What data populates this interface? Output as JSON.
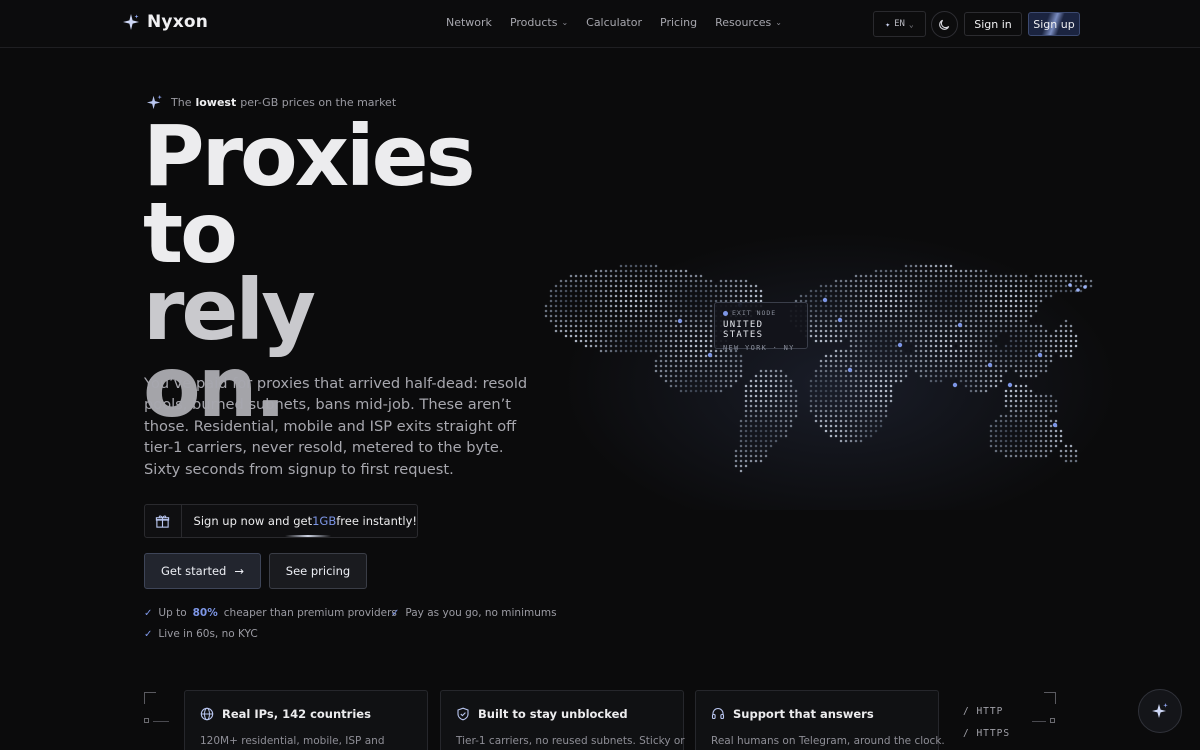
{
  "nav": {
    "brand": "Nyxon",
    "links": [
      "Network",
      "Products",
      "Calculator",
      "Pricing",
      "Resources"
    ],
    "language": "EN",
    "sign_in": "Sign in",
    "sign_up": "Sign up"
  },
  "hero": {
    "tagline_prefix": "The",
    "tagline_bold": "lowest",
    "tagline_suffix": "per-GB prices on the market",
    "title_line1": "Proxies to",
    "title_line2": "rely",
    "title_line3": "on.",
    "description": "You’ve paid for proxies that arrived half-dead: resold pools, burned subnets, bans mid-job. These aren’t those. Residential, mobile and ISP exits straight off tier-1 carriers, never resold, metered to the byte. Sixty seconds from signup to first request.",
    "promo_prefix": "Sign up now and get",
    "promo_accent": "1GB",
    "promo_suffix": "free instantly!",
    "cta_primary": "Get started",
    "cta_arrow": "→",
    "cta_secondary": "See pricing",
    "features": {
      "f1_prefix": "Up to",
      "f1_value": "80%",
      "f1_suffix": "cheaper than premium providers",
      "f2": "Pay as you go, no minimums",
      "f3": "Live in 60s, no KYC"
    }
  },
  "map": {
    "exit_label": "EXIT NODE",
    "exit_country": "UNITED STATES",
    "exit_city": "NEW YORK · NY",
    "accent": "#7d96e6"
  },
  "cards": [
    {
      "icon": "globe-icon",
      "title": "Real IPs, 142 countries",
      "body": "120M+ residential, mobile, ISP and"
    },
    {
      "icon": "shield-icon",
      "title": "Built to stay unblocked",
      "body": "Tier-1 carriers, no reused subnets. Sticky or"
    },
    {
      "icon": "headset-icon",
      "title": "Support that answers",
      "body": "Real humans on Telegram, around the clock."
    }
  ],
  "protocols": [
    "/ HTTP",
    "/ HTTPS"
  ],
  "colors": {
    "background": "#0b0b0c",
    "accent": "#7d96e6",
    "text": "#ececee",
    "muted": "#9b9ba3"
  }
}
